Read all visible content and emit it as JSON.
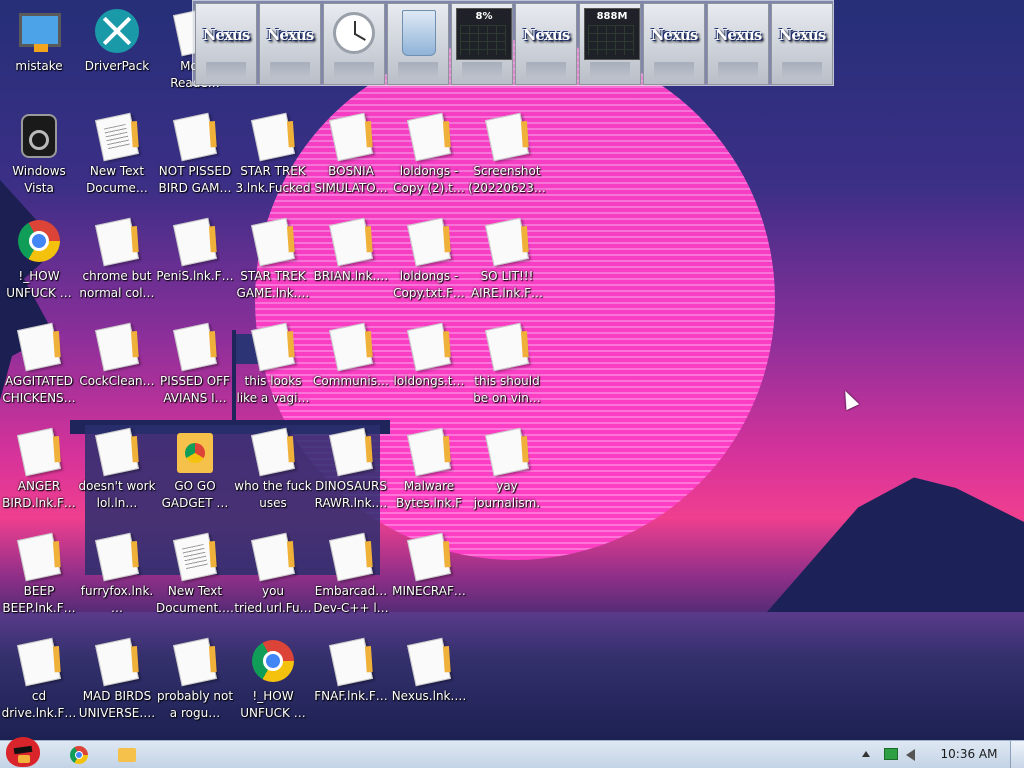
{
  "colors": {
    "taskbar": "#c3d3e6",
    "sun": "#ff3fc6",
    "sky_top": "#262f78",
    "label_text": "#ffffff"
  },
  "dock": {
    "items": [
      {
        "kind": "nexus",
        "text": "Nexus"
      },
      {
        "kind": "nexus",
        "text": "Nexus"
      },
      {
        "kind": "clock",
        "text": ""
      },
      {
        "kind": "recycle-bin",
        "text": ""
      },
      {
        "kind": "cpu-meter",
        "text": "8%"
      },
      {
        "kind": "nexus",
        "text": "Nexus"
      },
      {
        "kind": "ram-meter",
        "text": "888M"
      },
      {
        "kind": "nexus",
        "text": "Nexus"
      },
      {
        "kind": "nexus",
        "text": "Nexus"
      },
      {
        "kind": "nexus",
        "text": "Nexus"
      }
    ]
  },
  "desktop": {
    "icons": [
      {
        "label": "mistake",
        "icon": "monitor-icon"
      },
      {
        "label": "DriverPack",
        "icon": "driverpack-icon"
      },
      {
        "label": "Mo… Reade…",
        "icon": "document-icon"
      },
      {
        "label": "Windows Vista",
        "icon": "vista-icon"
      },
      {
        "label": "New Text Docume…",
        "icon": "text-document-icon"
      },
      {
        "label": "NOT PISSED BIRD GAM…",
        "icon": "document-icon"
      },
      {
        "label": "STAR TREK 3.lnk.Fucked",
        "icon": "document-icon"
      },
      {
        "label": "BOSNIA SIMULATO…",
        "icon": "document-icon"
      },
      {
        "label": "loldongs - Copy (2).t…",
        "icon": "document-icon"
      },
      {
        "label": "Screenshot (20220623…",
        "icon": "document-icon"
      },
      {
        "label": "!_HOW UNFUCK …",
        "icon": "chrome-icon"
      },
      {
        "label": "chrome but normal col…",
        "icon": "document-icon"
      },
      {
        "label": "PeniS.lnk.F…",
        "icon": "document-icon"
      },
      {
        "label": "STAR TREK GAME.lnk.…",
        "icon": "document-icon"
      },
      {
        "label": "BRIAN.lnk.…",
        "icon": "document-icon"
      },
      {
        "label": "loldongs - Copy.txt.F…",
        "icon": "document-icon"
      },
      {
        "label": "SO LIT!!! AIRE.lnk.F…",
        "icon": "document-icon"
      },
      {
        "label": "AGGITATED CHICKENS…",
        "icon": "document-icon"
      },
      {
        "label": "CockClean…",
        "icon": "document-icon"
      },
      {
        "label": "PISSED OFF AVIANS I…",
        "icon": "document-icon"
      },
      {
        "label": "this looks like a vagi…",
        "icon": "document-icon"
      },
      {
        "label": "Communis…",
        "icon": "document-icon"
      },
      {
        "label": "loldongs.t…",
        "icon": "document-icon"
      },
      {
        "label": "this should be on vin…",
        "icon": "document-icon"
      },
      {
        "label": "ANGER BIRD.lnk.F…",
        "icon": "document-icon"
      },
      {
        "label": "doesn't work lol.ln…",
        "icon": "document-icon"
      },
      {
        "label": "GO GO GADGET …",
        "icon": "chrome-folder-icon"
      },
      {
        "label": "who the fuck uses this.ln…",
        "icon": "document-icon"
      },
      {
        "label": "DINOSAURS RAWR.lnk.…",
        "icon": "document-icon"
      },
      {
        "label": "Malware Bytes.lnk.F…",
        "icon": "document-icon"
      },
      {
        "label": "yay journalism.…",
        "icon": "document-icon"
      },
      {
        "label": "BEEP BEEP.lnk.F…",
        "icon": "document-icon"
      },
      {
        "label": "furryfox.lnk.…",
        "icon": "document-icon"
      },
      {
        "label": "New Text Document.…",
        "icon": "text-document-icon"
      },
      {
        "label": "you tried.url.Fu…",
        "icon": "document-icon"
      },
      {
        "label": "Embarcad… Dev-C++ l…",
        "icon": "document-icon"
      },
      {
        "label": "MINECRAF…",
        "icon": "document-icon"
      },
      {
        "label": "cd drive.lnk.F…",
        "icon": "document-icon"
      },
      {
        "label": "MAD BIRDS UNIVERSE.…",
        "icon": "document-icon"
      },
      {
        "label": "probably not a rogu…",
        "icon": "document-icon"
      },
      {
        "label": "!_HOW UNFUCK …",
        "icon": "chrome-icon"
      },
      {
        "label": "FNAF.lnk.F…",
        "icon": "document-icon"
      },
      {
        "label": "Nexus.lnk.…",
        "icon": "document-icon"
      }
    ]
  },
  "taskbar": {
    "start_icon": "angry-bird-icon",
    "pinned": [
      {
        "icon": "chrome-icon"
      },
      {
        "icon": "explorer-folder-icon"
      }
    ],
    "tray": {
      "clock": "10:36 AM"
    }
  }
}
